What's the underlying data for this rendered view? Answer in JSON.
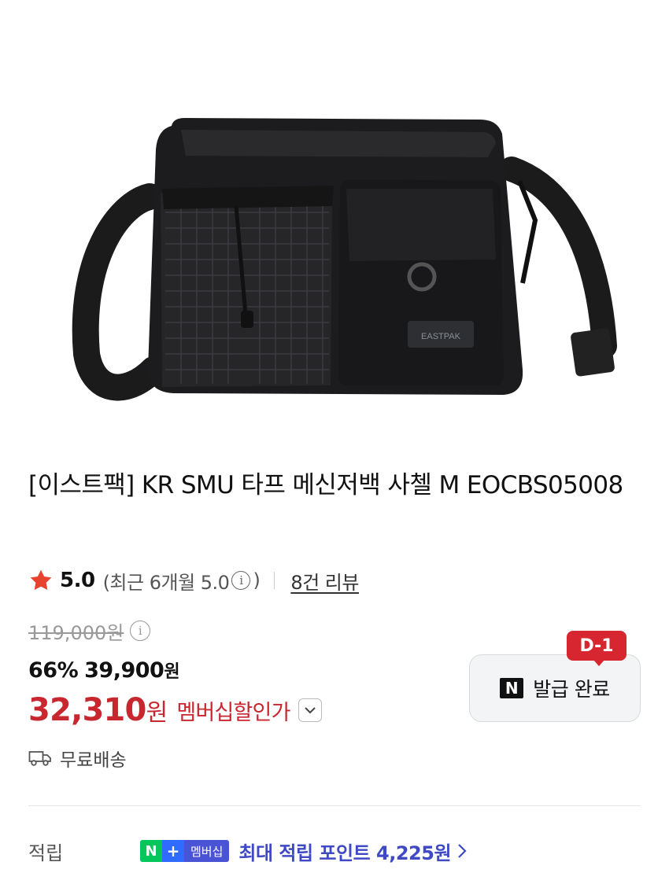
{
  "product": {
    "title": "[이스트팩] KR SMU 타프 메신저백 사첼 M EOCBS05008",
    "brand_logo_text": "EASTPAK"
  },
  "rating": {
    "score": "5.0",
    "recent_label": "(최근 6개월 5.0",
    "recent_close": ")",
    "info_glyph": "i",
    "review_link": "8건 리뷰"
  },
  "price": {
    "original": "119,000원",
    "info_glyph": "i",
    "discount_pct": "66%",
    "sale_amount": "39,900",
    "sale_unit": "원",
    "member_amount": "32,310",
    "member_unit": "원",
    "member_label": "멤버십할인가"
  },
  "coupon": {
    "dday": "D-1",
    "logo": "N",
    "label": "발급 완료"
  },
  "shipping": {
    "label": "무료배송"
  },
  "points": {
    "label": "적립",
    "badge_n": "N",
    "badge_plus": "+",
    "badge_member": "멤버십",
    "text": "최대 적립 포인트 4,225원"
  },
  "colors": {
    "accent_red": "#c8272f",
    "dday_red": "#d72630",
    "naver_green": "#03c75a",
    "points_blue": "#3f49c5",
    "star": "#e8432f"
  },
  "icons": {
    "star": "star-icon",
    "info": "info-icon",
    "dropdown": "chevron-down-icon",
    "truck": "truck-icon",
    "chevron": "chevron-right-icon"
  }
}
